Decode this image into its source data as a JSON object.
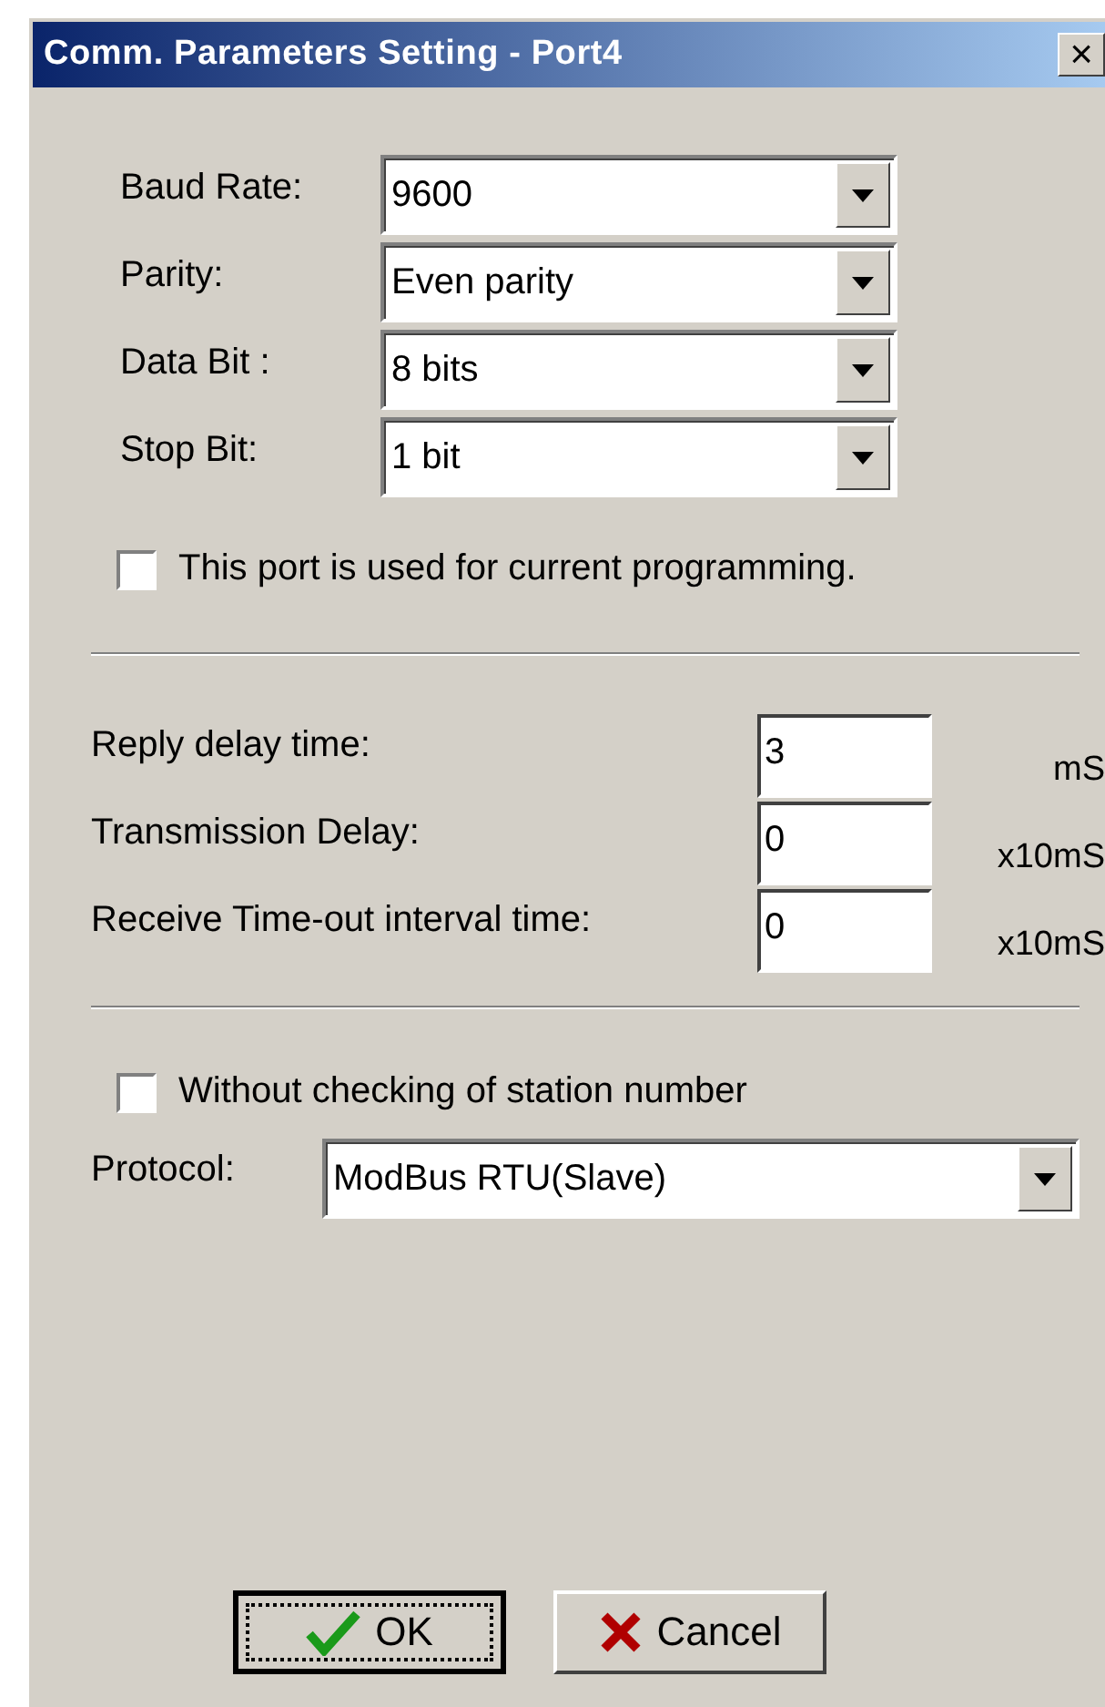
{
  "window": {
    "title": "Comm. Parameters Setting - Port4",
    "close": "×"
  },
  "serial": [
    {
      "label": "Baud Rate:",
      "value": "9600"
    },
    {
      "label": "Parity:",
      "value": "Even parity"
    },
    {
      "label": "Data Bit :",
      "value": "8 bits"
    },
    {
      "label": "Stop Bit:",
      "value": "1 bit"
    }
  ],
  "programming_port": {
    "label": "This port is used for current programming.",
    "checked": false
  },
  "timing": [
    {
      "label": "Reply delay time:",
      "value": "3",
      "unit": "mS"
    },
    {
      "label": "Transmission Delay:",
      "value": "0",
      "unit": "x10mS"
    },
    {
      "label": "Receive Time-out interval time:",
      "value": "0",
      "unit": "x10mS"
    }
  ],
  "no_station_check": {
    "label": "Without checking of station number",
    "checked": false
  },
  "protocol": {
    "label": "Protocol:",
    "value": "ModBus RTU(Slave)"
  },
  "buttons": [
    {
      "kind": "ok",
      "label": "OK",
      "focused": true
    },
    {
      "kind": "cancel",
      "label": "Cancel",
      "focused": false
    }
  ]
}
